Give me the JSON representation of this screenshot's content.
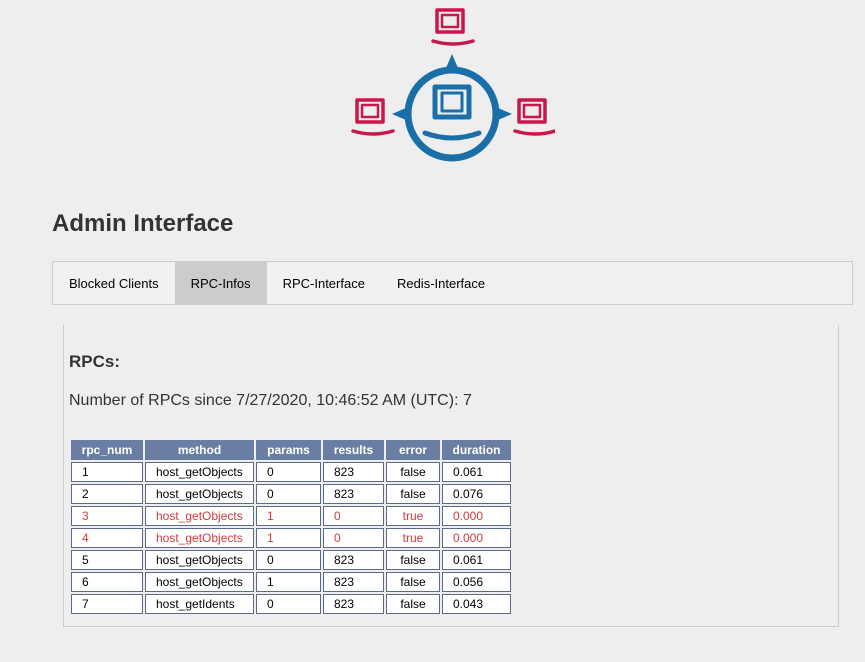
{
  "app": {
    "logo_icon": "opsi-network-logo-icon",
    "title": "Admin Interface"
  },
  "colors": {
    "logo_red": "#c8174b",
    "logo_blue": "#1a6fa8",
    "table_header": "#6a7ea4",
    "error_text": "#d03b3b",
    "active_tab": "#cccccc"
  },
  "tabs": [
    {
      "label": "Blocked Clients",
      "active": false
    },
    {
      "label": "RPC-Infos",
      "active": true
    },
    {
      "label": "RPC-Interface",
      "active": false
    },
    {
      "label": "Redis-Interface",
      "active": false
    }
  ],
  "rpcs": {
    "heading": "RPCs:",
    "summary_label": "Number of RPCs since 7/27/2020, 10:46:52 AM (UTC):",
    "summary_count": "7",
    "columns": [
      "rpc_num",
      "method",
      "params",
      "results",
      "error",
      "duration"
    ],
    "rows": [
      {
        "rpc_num": "1",
        "method": "host_getObjects",
        "params": "0",
        "results": "823",
        "error": "false",
        "duration": "0.061"
      },
      {
        "rpc_num": "2",
        "method": "host_getObjects",
        "params": "0",
        "results": "823",
        "error": "false",
        "duration": "0.076"
      },
      {
        "rpc_num": "3",
        "method": "host_getObjects",
        "params": "1",
        "results": "0",
        "error": "true",
        "duration": "0.000"
      },
      {
        "rpc_num": "4",
        "method": "host_getObjects",
        "params": "1",
        "results": "0",
        "error": "true",
        "duration": "0.000"
      },
      {
        "rpc_num": "5",
        "method": "host_getObjects",
        "params": "0",
        "results": "823",
        "error": "false",
        "duration": "0.061"
      },
      {
        "rpc_num": "6",
        "method": "host_getObjects",
        "params": "1",
        "results": "823",
        "error": "false",
        "duration": "0.056"
      },
      {
        "rpc_num": "7",
        "method": "host_getIdents",
        "params": "0",
        "results": "823",
        "error": "false",
        "duration": "0.043"
      }
    ]
  }
}
